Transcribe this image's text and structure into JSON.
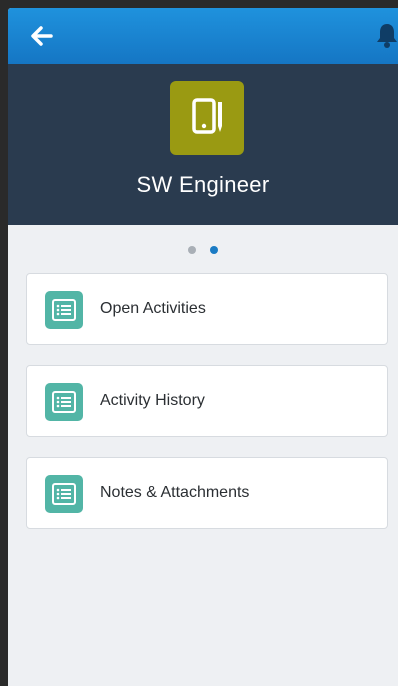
{
  "colors": {
    "topbar": "#1a86d0",
    "header": "#2a3b4f",
    "record_icon_bg": "#9a9a12",
    "card_icon_bg": "#52b5a6",
    "page_bg": "#eef0f3",
    "dot_active": "#1a7bc4",
    "dot_inactive": "#a9afb6"
  },
  "topbar": {
    "back_icon": "arrow-left-icon",
    "notification_icon": "bell-icon"
  },
  "header": {
    "icon": "mobile-device-pen-icon",
    "title": "SW Engineer"
  },
  "pager": {
    "count": 2,
    "active_index": 1
  },
  "related_lists": [
    {
      "label": "Open Activities",
      "icon": "list-icon"
    },
    {
      "label": "Activity History",
      "icon": "list-icon"
    },
    {
      "label": "Notes & Attachments",
      "icon": "list-icon"
    }
  ]
}
